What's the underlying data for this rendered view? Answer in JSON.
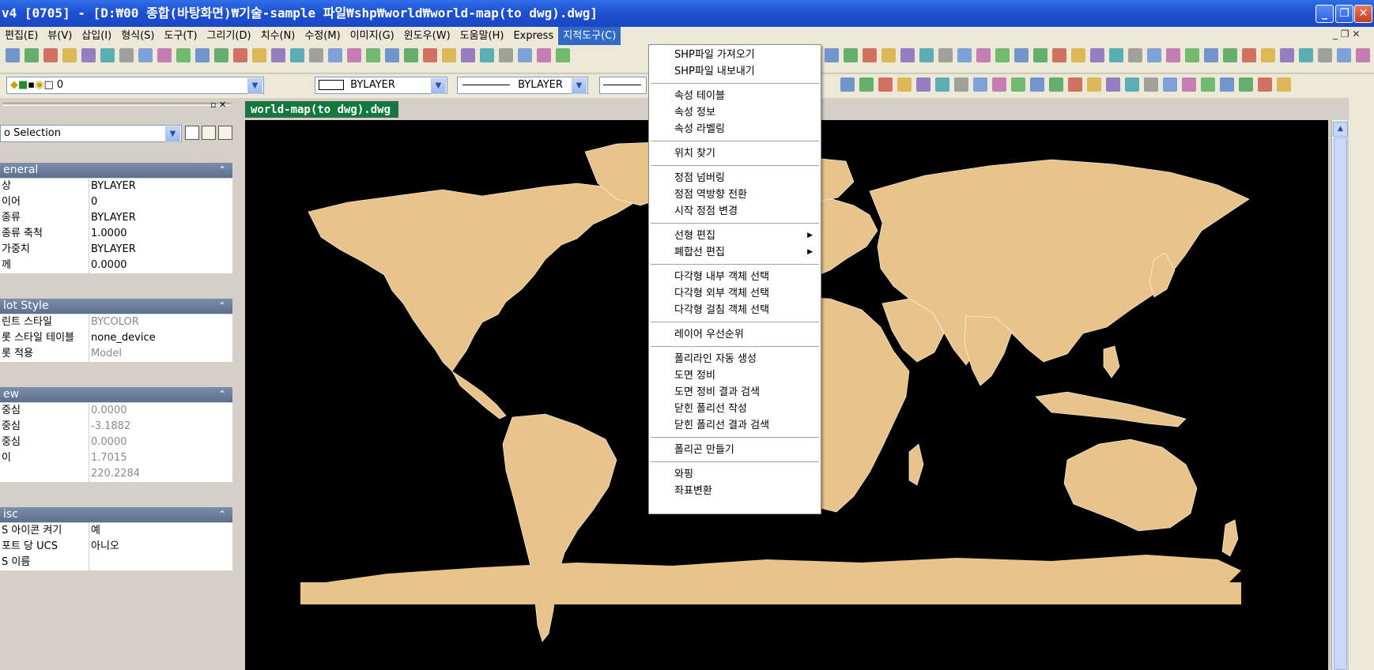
{
  "window": {
    "title": "v4 [0705] - [D:₩00 종합(바탕화면)₩기술-sample 파일₩shp₩world₩world-map(to dwg).dwg]"
  },
  "menubar": {
    "items": [
      "편집(E)",
      "뷰(V)",
      "삽입(I)",
      "형식(S)",
      "도구(T)",
      "그리기(D)",
      "치수(N)",
      "수정(M)",
      "이미지(G)",
      "윈도우(W)",
      "도움말(H)",
      "Express",
      "지적도구(C)"
    ]
  },
  "toolbar": {
    "layer_value": "0",
    "color_combo": "BYLAYER",
    "linetype_combo": "BYLAYER"
  },
  "properties": {
    "selection": "o Selection",
    "sections": [
      {
        "title": "eneral",
        "rows": [
          {
            "key": "상",
            "value": "BYLAYER"
          },
          {
            "key": "이어",
            "value": "0"
          },
          {
            "key": "종류",
            "value": "BYLAYER"
          },
          {
            "key": "종류 축척",
            "value": "1.0000"
          },
          {
            "key": "가중치",
            "value": "BYLAYER"
          },
          {
            "key": "께",
            "value": "0.0000"
          }
        ]
      },
      {
        "title": "lot Style",
        "rows": [
          {
            "key": "린트 스타일",
            "value": "BYCOLOR"
          },
          {
            "key": "롯 스타일 테이블",
            "value": "none_device"
          },
          {
            "key": "롯 적용",
            "value": "Model"
          }
        ]
      },
      {
        "title": "ew",
        "rows": [
          {
            "key": "중심",
            "value": "0.0000"
          },
          {
            "key": "중심",
            "value": "-3.1882"
          },
          {
            "key": "중심",
            "value": "0.0000"
          },
          {
            "key": "이",
            "value": "1.7015"
          },
          {
            "key": "",
            "value": "220.2284"
          }
        ]
      },
      {
        "title": "isc",
        "rows": [
          {
            "key": "S 아이콘 켜기",
            "value": "예"
          },
          {
            "key": "포트 당 UCS",
            "value": "아니오"
          },
          {
            "key": "S 이름",
            "value": ""
          }
        ]
      }
    ]
  },
  "document_tab": "world-map(to dwg).dwg",
  "dropdown": {
    "groups": [
      [
        {
          "label": "SHP파일 가져오기"
        },
        {
          "label": "SHP파일 내보내기"
        }
      ],
      [
        {
          "label": "속성 테이블"
        },
        {
          "label": "속성 정보"
        },
        {
          "label": "속성 라벨링"
        }
      ],
      [
        {
          "label": "위치 찾기"
        }
      ],
      [
        {
          "label": "정점 넘버링"
        },
        {
          "label": "정점 역방향 전환"
        },
        {
          "label": "시작 정점 변경"
        }
      ],
      [
        {
          "label": "선형 편집",
          "submenu": true
        },
        {
          "label": "폐합선 편집",
          "submenu": true
        }
      ],
      [
        {
          "label": "다각형 내부 객체 선택"
        },
        {
          "label": "다각형 외부 객체 선택"
        },
        {
          "label": "다각형 걸침 객체 선택"
        }
      ],
      [
        {
          "label": "레이어 우선순위"
        }
      ],
      [
        {
          "label": "폴리라인 자동 생성"
        },
        {
          "label": "도면 정비"
        },
        {
          "label": "도면 정비 결과 검색"
        },
        {
          "label": "닫힌 폴리선 작성"
        },
        {
          "label": "닫힌 폴리선 결과 검색"
        }
      ],
      [
        {
          "label": "폴리곤 만들기"
        }
      ],
      [
        {
          "label": "와핑"
        },
        {
          "label": "좌표변환"
        }
      ]
    ]
  },
  "colors": {
    "land": "#e8c48a",
    "ocean": "#000000",
    "menu_highlight": "#316ac5"
  }
}
